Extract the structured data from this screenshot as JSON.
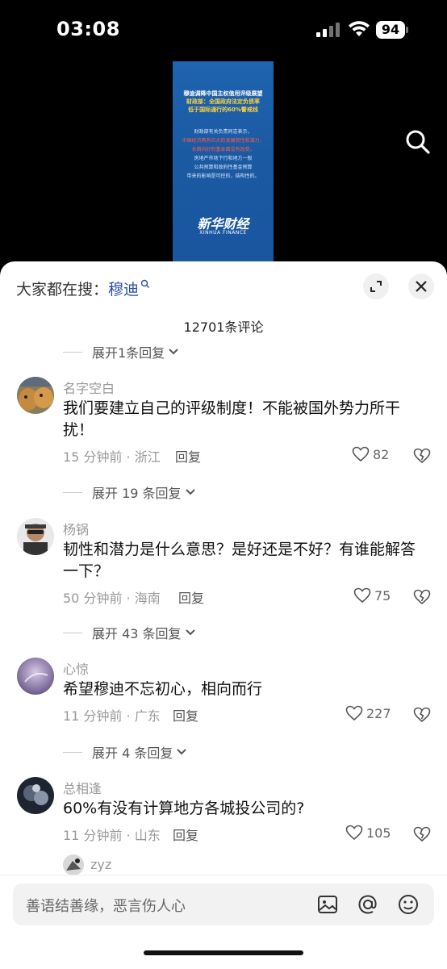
{
  "status": {
    "time": "03:08",
    "battery": "94"
  },
  "poster": {
    "headline1": "穆迪调降中国主权信用评级展望",
    "headline2": "财政部：全国政府法定负债率",
    "headline3": "低于国际通行的60%警戒线",
    "body1": "财政部有关负责同志表示，",
    "body2": "中国经济具有巨大的发展韧性和潜力，",
    "body3": "长期向好的基本面没有改变。",
    "body4": "房地产市场下行和地方一般",
    "body5": "公共预算和政府性基金预算",
    "body6": "带来的影响是可控的，结构性的。",
    "logo": "新华财经",
    "logo_sub": "XINHUA FINANCE"
  },
  "sheet": {
    "trending_label": "大家都在搜：",
    "trending_keyword": "穆迪",
    "comment_count": "12701条评论",
    "expand_top": "展开1条回复"
  },
  "comments": [
    {
      "name": "名字空白",
      "text": "我们要建立自己的评级制度！不能被国外势力所干扰！",
      "meta": "15 分钟前 · 浙江",
      "reply": "回复",
      "likes": "82",
      "expand": "展开 19 条回复"
    },
    {
      "name": "杨锅",
      "text": "韧性和潜力是什么意思？是好还是不好？有谁能解答一下？",
      "meta": "50 分钟前 · 海南",
      "reply": "回复",
      "likes": "75",
      "expand": "展开 43 条回复"
    },
    {
      "name": "心惊",
      "text": "希望穆迪不忘初心，相向而行",
      "meta": "11 分钟前 · 广东",
      "reply": "回复",
      "likes": "227",
      "expand": "展开 4 条回复"
    },
    {
      "name": "总相逢",
      "text": "60%有没有计算地方各城投公司的?",
      "meta": "11 分钟前 · 山东",
      "reply": "回复",
      "likes": "105"
    },
    {
      "name": "zyz"
    }
  ],
  "input": {
    "placeholder": "善语结善缘，恶言伤人心"
  },
  "icons": {
    "search": "search-icon",
    "expand": "fullscreen-icon",
    "close": "close-icon",
    "heart": "heart-icon",
    "broken_heart": "broken-heart-icon",
    "image": "image-icon",
    "mention": "at-icon",
    "emoji": "emoji-icon"
  }
}
